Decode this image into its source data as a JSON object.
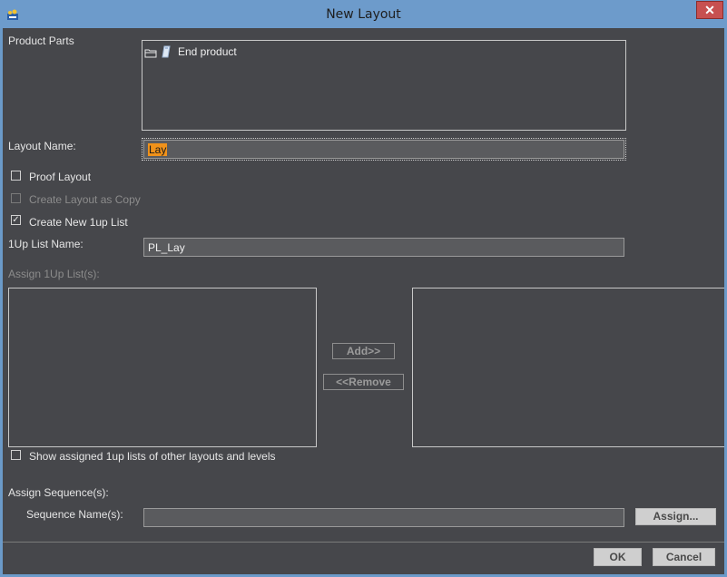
{
  "window": {
    "title": "New Layout",
    "close_glyph": "✕"
  },
  "product_parts": {
    "label": "Product Parts",
    "items": [
      {
        "label": "End product",
        "icons": [
          "folder-icon",
          "part-icon"
        ]
      }
    ]
  },
  "layout_name": {
    "label": "Layout Name:",
    "value": "Lay"
  },
  "options": {
    "proof_layout": {
      "label": "Proof Layout",
      "checked": false,
      "enabled": true
    },
    "create_layout_copy": {
      "label": "Create Layout as Copy",
      "checked": false,
      "enabled": false
    },
    "create_new_1up_list": {
      "label": "Create New 1up List",
      "checked": true,
      "enabled": true
    }
  },
  "oneup_list_name": {
    "label": "1Up List Name:",
    "value": "PL_Lay"
  },
  "assign_1up": {
    "label": "Assign 1Up List(s):",
    "add_label": "Add>>",
    "remove_label": "<<Remove",
    "show_assigned_label": "Show assigned 1up lists of other layouts and levels",
    "show_assigned_checked": false
  },
  "assign_sequence": {
    "label": "Assign Sequence(s):",
    "sequence_name_label": "Sequence Name(s):",
    "sequence_value": "",
    "assign_label": "Assign..."
  },
  "footer": {
    "ok_label": "OK",
    "cancel_label": "Cancel"
  },
  "colors": {
    "client_bg": "#46474b",
    "titlebar_bg": "#6d9bcb",
    "selection": "#f0921a",
    "close_bg": "#c75050"
  }
}
